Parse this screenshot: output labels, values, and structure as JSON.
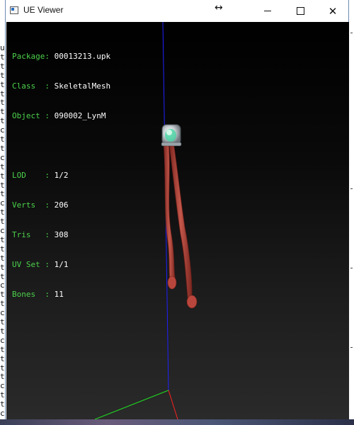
{
  "background": {
    "letters": [
      "u",
      "t",
      "t",
      "t",
      "t",
      "t",
      "t",
      "t",
      "t",
      "c",
      "t",
      "t",
      "c",
      "t",
      "t",
      "t",
      "t",
      "c",
      "t",
      "t",
      "c",
      "t",
      "t",
      "t",
      "t",
      "t",
      "c",
      "t",
      "t",
      "c",
      "t",
      "t",
      "c",
      "t",
      "t",
      "t",
      "t",
      "c",
      "t",
      "t",
      "c"
    ]
  },
  "window": {
    "title": "UE Viewer",
    "cursor_glyph": "↔",
    "close_glyph": "✕"
  },
  "info": {
    "package": {
      "key": "Package: ",
      "value": "00013213.upk"
    },
    "class": {
      "key": "Class  : ",
      "value": "SkeletalMesh"
    },
    "object": {
      "key": "Object : ",
      "value": "090002_LynM"
    },
    "lod": {
      "key": "LOD    : ",
      "value": "1/2"
    },
    "verts": {
      "key": "Verts  : ",
      "value": "206"
    },
    "tris": {
      "key": "Tris   : ",
      "value": "308"
    },
    "uvset": {
      "key": "UV Set : ",
      "value": "1/1"
    },
    "bones": {
      "key": "Bones  : ",
      "value": "11"
    }
  },
  "colors": {
    "label_green": "#4cd14c",
    "value_white": "#ffffff",
    "axis_x": "#ff2020",
    "axis_y": "#20e020",
    "axis_z": "#2020ff",
    "mesh_red": "#b5463c",
    "mesh_cap": "#d8dde0",
    "mesh_glow": "#3fd6a0"
  },
  "viewport": {
    "object_icon": "skeletal-mesh"
  }
}
